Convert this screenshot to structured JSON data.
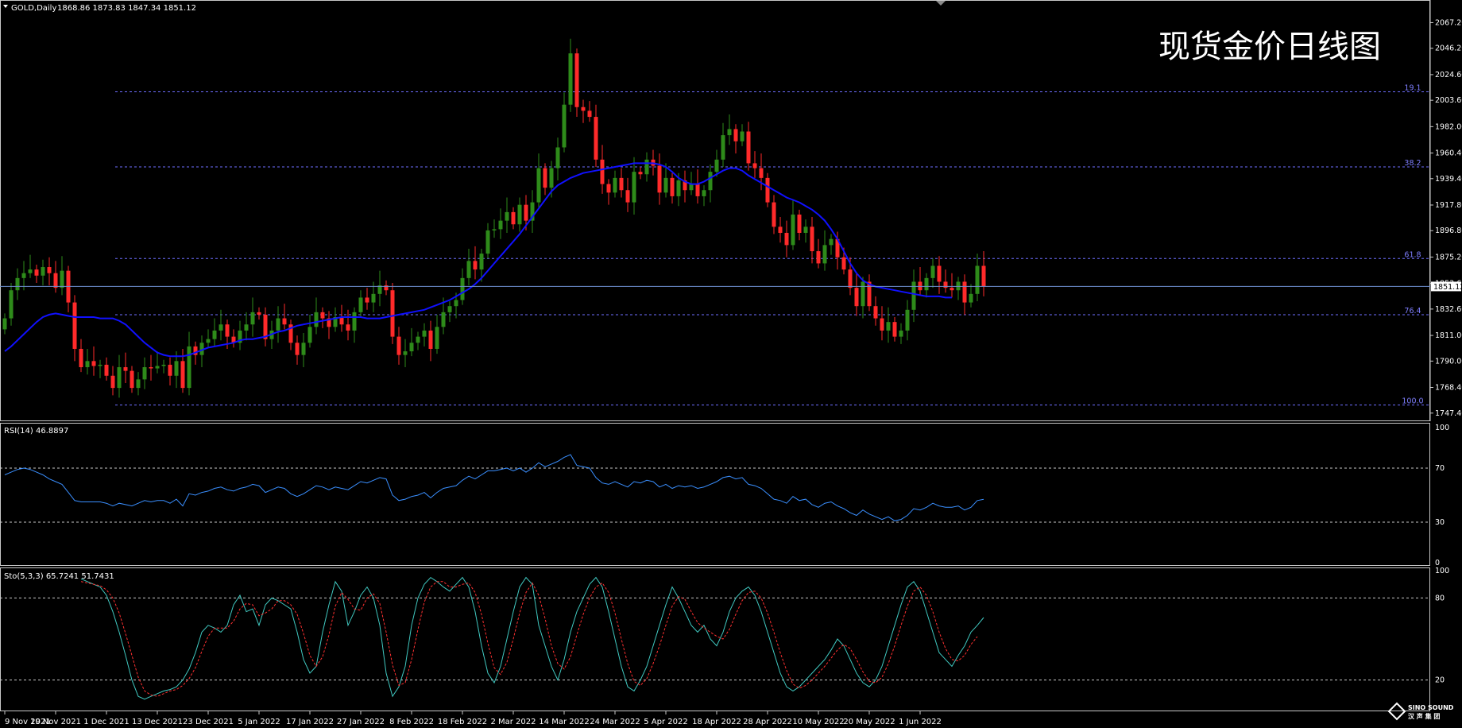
{
  "header": {
    "symbol_label": "GOLD,Daily",
    "ohlc": "1868.86 1873.83 1847.34 1851.12"
  },
  "overlay_title": "现货金价日线图",
  "price_axis": {
    "ticks": [
      1747.4,
      1768.4,
      1790.0,
      1811.0,
      1832.6,
      1853.6,
      1875.2,
      1896.8,
      1917.8,
      1939.4,
      1960.4,
      1982.0,
      2003.6,
      2024.6,
      2046.2,
      2067.2
    ],
    "current_price": "1851.12",
    "current_value": 1851.12,
    "range": [
      1744,
      2074
    ]
  },
  "fib_levels": [
    {
      "label": "19.1",
      "value": 2010.5
    },
    {
      "label": "38.2",
      "value": 1949.0
    },
    {
      "label": "61.8",
      "value": 1874.0
    },
    {
      "label": "76.4",
      "value": 1828.0
    },
    {
      "label": "100.0",
      "value": 1754.0
    }
  ],
  "rsi": {
    "label": "RSI(14) 46.8897",
    "levels": [
      30,
      70
    ],
    "axis_ticks": [
      {
        "value": 100,
        "label": "100"
      },
      {
        "value": 70,
        "label": "70"
      },
      {
        "value": 30,
        "label": "30"
      },
      {
        "value": 0,
        "label": "0"
      }
    ]
  },
  "stoch": {
    "label": "Sto(5,3,3) 65.7241 51.7431",
    "levels": [
      20,
      80
    ],
    "axis_ticks": [
      {
        "value": 100,
        "label": "100"
      },
      {
        "value": 80,
        "label": "80"
      },
      {
        "value": 20,
        "label": "20"
      }
    ]
  },
  "time_axis": {
    "labels": [
      {
        "i": 0,
        "text": "9 Nov 2021"
      },
      {
        "i": 8,
        "text": "19 Nov 2021"
      },
      {
        "i": 16,
        "text": "1 Dec 2021"
      },
      {
        "i": 24,
        "text": "13 Dec 2021"
      },
      {
        "i": 32,
        "text": "23 Dec 2021"
      },
      {
        "i": 40,
        "text": "5 Jan 2022"
      },
      {
        "i": 48,
        "text": "17 Jan 2022"
      },
      {
        "i": 56,
        "text": "27 Jan 2022"
      },
      {
        "i": 64,
        "text": "8 Feb 2022"
      },
      {
        "i": 72,
        "text": "18 Feb 2022"
      },
      {
        "i": 80,
        "text": "2 Mar 2022"
      },
      {
        "i": 88,
        "text": "14 Mar 2022"
      },
      {
        "i": 96,
        "text": "24 Mar 2022"
      },
      {
        "i": 104,
        "text": "5 Apr 2022"
      },
      {
        "i": 112,
        "text": "18 Apr 2022"
      },
      {
        "i": 120,
        "text": "28 Apr 2022"
      },
      {
        "i": 128,
        "text": "10 May 2022"
      },
      {
        "i": 136,
        "text": "20 May 2022"
      },
      {
        "i": 144,
        "text": "1 Jun 2022"
      }
    ]
  },
  "logo": {
    "name": "SINO SOUND",
    "sub": "汉 声 集 团"
  },
  "colors": {
    "background": "#000000",
    "bull": "#2e8b1a",
    "bear": "#ff2a2a",
    "ma": "#1010ff",
    "rsi": "#3a8fff",
    "stoch_main": "#40c8c0",
    "stoch_signal": "#ff3030",
    "fib": "#6e6eff",
    "grid": "#c8c8c8"
  },
  "chart_data": {
    "type": "candlestick",
    "title": "现货金价日线图",
    "symbol": "GOLD,Daily",
    "ylim": [
      1744,
      2074
    ],
    "closes": [
      1825,
      1848,
      1858,
      1862,
      1865,
      1860,
      1867,
      1862,
      1850,
      1864,
      1838,
      1800,
      1785,
      1790,
      1786,
      1787,
      1778,
      1768,
      1785,
      1782,
      1768,
      1775,
      1785,
      1784,
      1786,
      1787,
      1778,
      1790,
      1768,
      1802,
      1795,
      1805,
      1808,
      1815,
      1820,
      1810,
      1805,
      1815,
      1820,
      1830,
      1828,
      1808,
      1815,
      1825,
      1820,
      1805,
      1795,
      1805,
      1818,
      1830,
      1825,
      1818,
      1826,
      1820,
      1815,
      1830,
      1842,
      1838,
      1845,
      1852,
      1848,
      1810,
      1795,
      1798,
      1805,
      1810,
      1815,
      1800,
      1818,
      1830,
      1835,
      1840,
      1858,
      1872,
      1865,
      1878,
      1897,
      1898,
      1905,
      1912,
      1902,
      1918,
      1905,
      1920,
      1948,
      1932,
      1948,
      1965,
      2000,
      2042,
      1998,
      1995,
      1990,
      1955,
      1935,
      1928,
      1940,
      1930,
      1920,
      1945,
      1943,
      1955,
      1950,
      1928,
      1940,
      1925,
      1938,
      1930,
      1935,
      1925,
      1930,
      1945,
      1955,
      1975,
      1980,
      1970,
      1978,
      1952,
      1948,
      1940,
      1920,
      1900,
      1895,
      1885,
      1910,
      1895,
      1900,
      1880,
      1870,
      1885,
      1890,
      1875,
      1865,
      1850,
      1835,
      1855,
      1835,
      1825,
      1815,
      1822,
      1810,
      1815,
      1832,
      1855,
      1848,
      1858,
      1868,
      1855,
      1850,
      1848,
      1855,
      1838,
      1845,
      1868,
      1851
    ],
    "ma": [
      1798,
      1802,
      1807,
      1812,
      1817,
      1822,
      1826,
      1828,
      1829,
      1828,
      1827,
      1826,
      1826,
      1826,
      1826,
      1825,
      1825,
      1825,
      1823,
      1820,
      1815,
      1810,
      1805,
      1801,
      1797,
      1795,
      1794,
      1794,
      1794,
      1795,
      1797,
      1799,
      1801,
      1802,
      1803,
      1804,
      1805,
      1807,
      1808,
      1808,
      1809,
      1810,
      1812,
      1814,
      1815,
      1817,
      1819,
      1820,
      1821,
      1822,
      1823,
      1824,
      1825,
      1826,
      1826,
      1826,
      1826,
      1825,
      1825,
      1825,
      1826,
      1827,
      1828,
      1829,
      1830,
      1831,
      1832,
      1834,
      1836,
      1838,
      1840,
      1843,
      1846,
      1849,
      1853,
      1858,
      1864,
      1870,
      1876,
      1882,
      1888,
      1894,
      1901,
      1908,
      1915,
      1922,
      1929,
      1934,
      1937,
      1940,
      1942,
      1944,
      1945,
      1946,
      1947,
      1948,
      1949,
      1950,
      1951,
      1952,
      1952,
      1952,
      1952,
      1951,
      1949,
      1945,
      1940,
      1937,
      1935,
      1935,
      1937,
      1940,
      1943,
      1946,
      1948,
      1948,
      1946,
      1942,
      1939,
      1936,
      1933,
      1930,
      1927,
      1924,
      1922,
      1920,
      1917,
      1914,
      1910,
      1905,
      1898,
      1890,
      1880,
      1870,
      1862,
      1856,
      1853,
      1851,
      1850,
      1849,
      1848,
      1847,
      1846,
      1845,
      1844,
      1843,
      1843,
      1843,
      1842,
      1842
    ],
    "rsi": [
      65,
      67,
      69,
      70,
      69,
      67,
      65,
      62,
      60,
      58,
      52,
      46,
      45,
      45,
      45,
      45,
      44,
      42,
      44,
      43,
      42,
      44,
      46,
      45,
      46,
      46,
      44,
      47,
      42,
      51,
      50,
      52,
      53,
      55,
      56,
      54,
      53,
      55,
      56,
      58,
      57,
      52,
      54,
      56,
      55,
      51,
      49,
      51,
      54,
      57,
      56,
      54,
      56,
      55,
      54,
      57,
      60,
      59,
      61,
      63,
      62,
      50,
      46,
      47,
      49,
      50,
      52,
      48,
      52,
      55,
      56,
      57,
      61,
      64,
      62,
      65,
      68,
      68,
      69,
      70,
      68,
      70,
      67,
      70,
      74,
      71,
      73,
      75,
      78,
      80,
      72,
      71,
      70,
      63,
      59,
      58,
      60,
      58,
      56,
      60,
      59,
      61,
      60,
      56,
      58,
      55,
      57,
      56,
      57,
      55,
      56,
      58,
      60,
      63,
      64,
      62,
      63,
      58,
      57,
      55,
      51,
      47,
      46,
      44,
      49,
      46,
      47,
      43,
      41,
      44,
      45,
      42,
      40,
      37,
      35,
      39,
      36,
      34,
      32,
      34,
      31,
      32,
      35,
      40,
      39,
      41,
      44,
      42,
      41,
      41,
      42,
      39,
      41,
      46,
      46.8897
    ],
    "stoch_main": [
      94,
      92,
      90,
      88,
      82,
      70,
      55,
      38,
      20,
      8,
      6,
      8,
      10,
      12,
      13,
      15,
      20,
      28,
      40,
      55,
      60,
      58,
      55,
      60,
      75,
      82,
      70,
      72,
      60,
      75,
      80,
      78,
      75,
      72,
      55,
      35,
      25,
      30,
      55,
      75,
      92,
      85,
      60,
      70,
      82,
      88,
      80,
      60,
      25,
      8,
      15,
      30,
      60,
      80,
      90,
      95,
      92,
      88,
      85,
      90,
      95,
      88,
      70,
      45,
      25,
      18,
      30,
      50,
      70,
      88,
      95,
      90,
      60,
      45,
      30,
      20,
      35,
      55,
      70,
      80,
      90,
      95,
      88,
      70,
      50,
      30,
      15,
      12,
      20,
      30,
      45,
      60,
      75,
      88,
      80,
      70,
      60,
      55,
      60,
      50,
      45,
      55,
      70,
      80,
      85,
      88,
      82,
      70,
      55,
      40,
      25,
      15,
      12,
      15,
      20,
      25,
      30,
      35,
      42,
      50,
      45,
      35,
      25,
      18,
      15,
      20,
      30,
      45,
      60,
      75,
      88,
      92,
      85,
      70,
      55,
      40,
      35,
      30,
      38,
      45,
      55,
      60,
      65.7241
    ],
    "stoch_signal": [
      92,
      91,
      90,
      89,
      86,
      80,
      69,
      54,
      38,
      22,
      12,
      9,
      8,
      10,
      12,
      13,
      16,
      21,
      29,
      41,
      52,
      58,
      58,
      58,
      63,
      72,
      76,
      75,
      67,
      69,
      72,
      78,
      78,
      75,
      68,
      54,
      38,
      30,
      37,
      53,
      74,
      84,
      79,
      72,
      71,
      80,
      83,
      76,
      55,
      31,
      16,
      18,
      35,
      57,
      77,
      88,
      92,
      92,
      88,
      88,
      90,
      91,
      84,
      68,
      47,
      29,
      24,
      33,
      50,
      69,
      84,
      91,
      82,
      65,
      45,
      32,
      28,
      37,
      53,
      68,
      80,
      88,
      91,
      84,
      69,
      50,
      32,
      19,
      16,
      21,
      32,
      45,
      60,
      74,
      81,
      79,
      70,
      62,
      58,
      55,
      52,
      50,
      57,
      68,
      78,
      84,
      85,
      80,
      69,
      55,
      40,
      27,
      17,
      14,
      16,
      20,
      25,
      30,
      36,
      42,
      46,
      43,
      35,
      26,
      19,
      18,
      22,
      32,
      45,
      60,
      74,
      85,
      88,
      82,
      70,
      55,
      43,
      35,
      34,
      38,
      46,
      51.7431
    ]
  }
}
